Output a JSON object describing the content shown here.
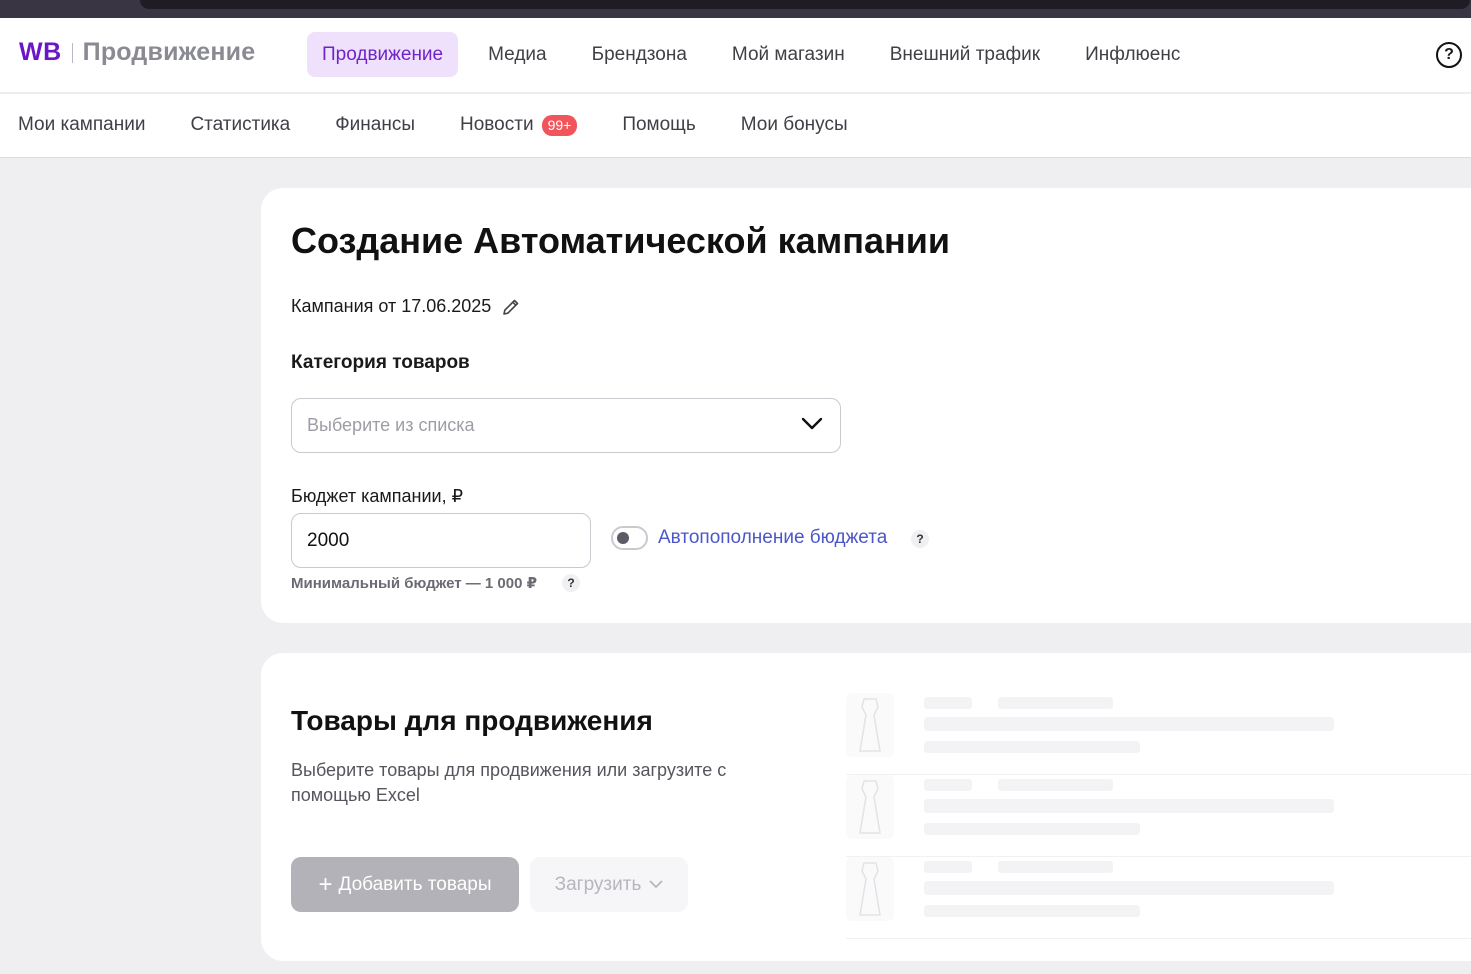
{
  "header": {
    "logo_wb": "WB",
    "logo_text": "Продвижение",
    "nav": [
      {
        "label": "Продвижение",
        "active": true
      },
      {
        "label": "Медиа",
        "active": false
      },
      {
        "label": "Брендзона",
        "active": false
      },
      {
        "label": "Мой магазин",
        "active": false
      },
      {
        "label": "Внешний трафик",
        "active": false
      },
      {
        "label": "Инфлюенс",
        "active": false
      }
    ],
    "help_icon": "?"
  },
  "subnav": {
    "items": [
      {
        "label": "Мои кампании"
      },
      {
        "label": "Статистика"
      },
      {
        "label": "Финансы"
      },
      {
        "label": "Новости",
        "badge": "99+"
      },
      {
        "label": "Помощь"
      },
      {
        "label": "Мои бонусы"
      }
    ]
  },
  "form": {
    "title": "Создание Автоматической кампании",
    "campaign_name": "Кампания от 17.06.2025",
    "category_label": "Категория товаров",
    "category_placeholder": "Выберите из списка",
    "budget_label": "Бюджет кампании, ₽",
    "budget_value": "2000",
    "autofill_toggle_on": false,
    "autofill_label": "Автопополнение бюджета",
    "q_mark": "?",
    "min_budget": "Минимальный бюджет — 1 000 ₽"
  },
  "products": {
    "title": "Товары для продвижения",
    "description": "Выберите товары для продвижения или загрузите с помощью Excel",
    "add_button": "Добавить товары",
    "add_plus": "+",
    "upload_button": "Загрузить"
  },
  "colors": {
    "brand": "#6b16c7",
    "active_tab_bg": "#efe1fb",
    "link": "#4d56c8",
    "badge": "#f2545b"
  }
}
